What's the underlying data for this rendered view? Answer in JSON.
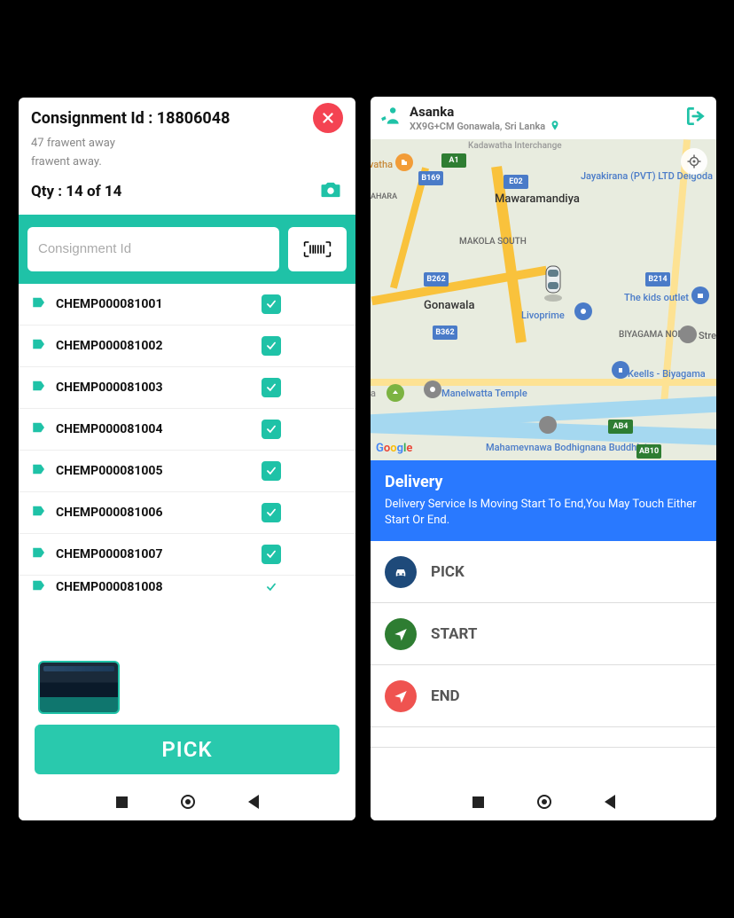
{
  "left": {
    "consignment_label": "Consignment Id : 18806048",
    "sub_line1": "47 frawent away",
    "sub_line2": "frawent away.",
    "qty_label": "Qty : 14 of 14",
    "search_placeholder": "Consignment Id",
    "items": [
      "CHEMP000081001",
      "CHEMP000081002",
      "CHEMP000081003",
      "CHEMP000081004",
      "CHEMP000081005",
      "CHEMP000081006",
      "CHEMP000081007",
      "CHEMP000081008"
    ],
    "pick_label": "PICK"
  },
  "right": {
    "user_name": "Asanka",
    "user_location": "XX9G+CM Gonawala, Sri Lanka",
    "map": {
      "top_cut": "Kadawatha Interchange",
      "labels": {
        "mawaramandiya": "Mawaramandiya",
        "makola": "MAKOLA SOUTH",
        "gonawala": "Gonawala",
        "biyagama_n": "BIYAGAMA NORTH",
        "vatha": "vatha",
        "ahara": "AHARA",
        "a": "a",
        "stre": "Stre"
      },
      "pois": {
        "livoprime": "Livoprime",
        "kids": "The kids outlet",
        "keells": "Keells - Biyagama",
        "manelwatta": "Manelwatta Temple",
        "mahamevnawa": "Mahamevnawa Bodhignana Buddhist",
        "jayakirana": "Jayakirana (PVT) LTD Delgoda"
      },
      "shields": {
        "a1": "A1",
        "b169": "B169",
        "e02": "E02",
        "b262": "B262",
        "b362": "B362",
        "b214": "B214",
        "ab4": "AB4",
        "ab10": "AB10"
      }
    },
    "delivery_title": "Delivery",
    "delivery_text": "Delivery Service Is Moving  Start To End,You May Touch Either Start Or End.",
    "actions": {
      "pick": "PICK",
      "start": "START",
      "end": "END"
    }
  }
}
